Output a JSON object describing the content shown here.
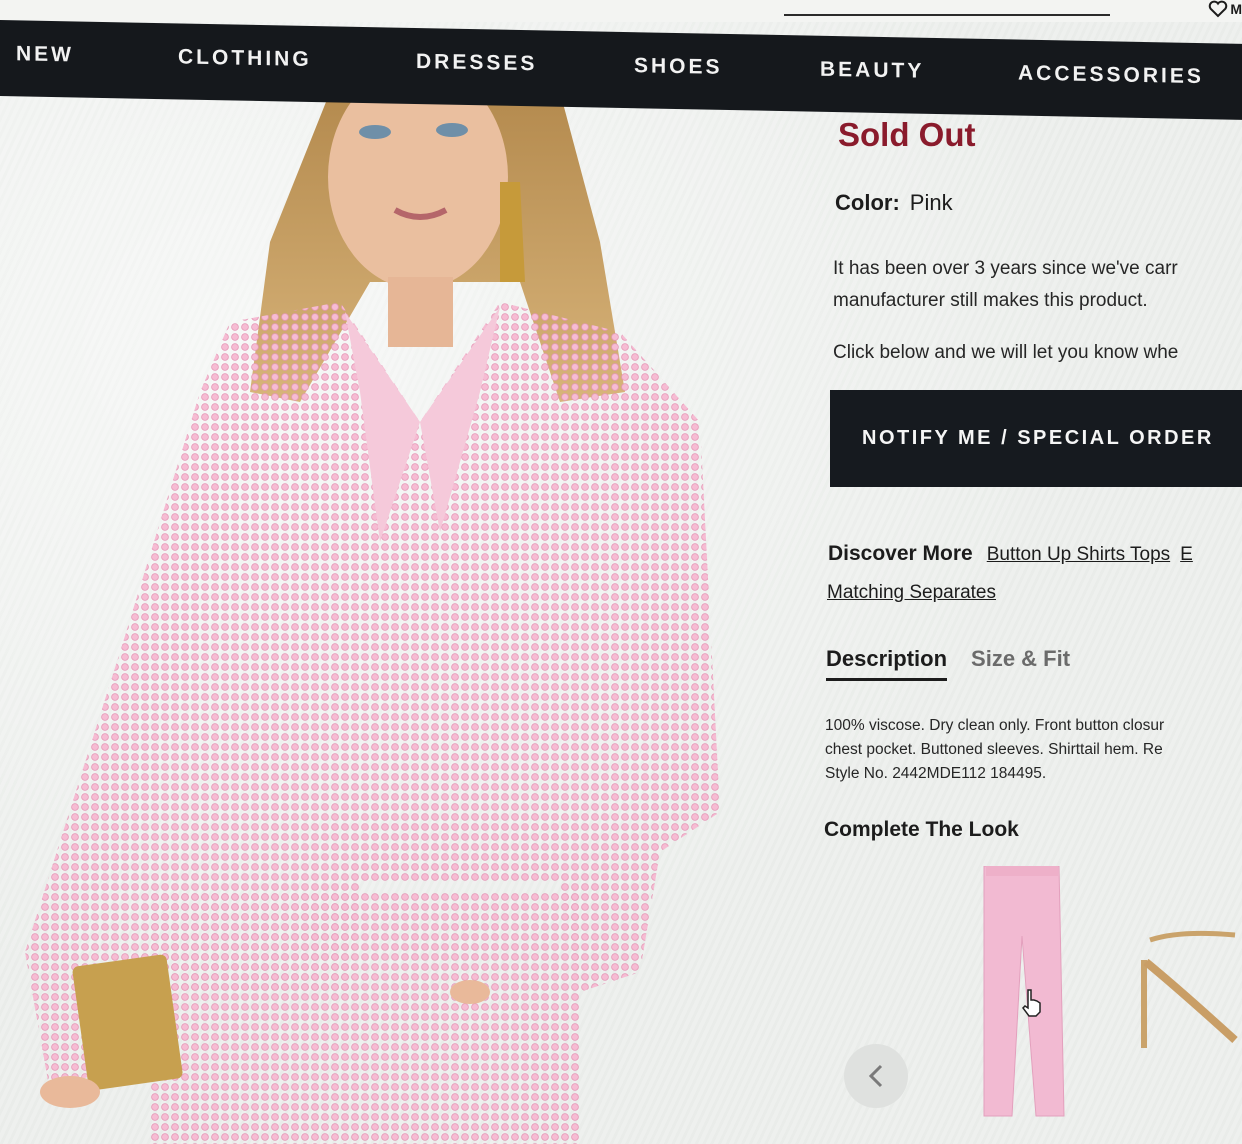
{
  "nav": {
    "items": [
      "NEW",
      "CLOTHING",
      "DRESSES",
      "SHOES",
      "BEAUTY",
      "ACCESSORIES"
    ]
  },
  "header": {
    "wishlist_label": "M",
    "wishlist_icon": "heart-icon"
  },
  "product": {
    "status": "Sold Out",
    "color_label": "Color:",
    "color_value": "Pink",
    "info_line1": "It has been over 3 years since we've carr",
    "info_line2": "manufacturer still makes this product.",
    "info_line3": "Click below and we will let you know whe",
    "notify_button": "NOTIFY ME / SPECIAL ORDER",
    "discover_label": "Discover More",
    "discover_links": [
      "Button Up Shirts Tops",
      "E",
      "Matching Separates"
    ],
    "tabs": [
      "Description",
      "Size & Fit"
    ],
    "description_lines": [
      "100% viscose. Dry clean only. Front button closur",
      "chest pocket. Buttoned sleeves. Shirttail hem. Re",
      "Style No. 2442MDE112 184495."
    ],
    "complete_look_title": "Complete The Look"
  },
  "colors": {
    "nav_bg": "#15181c",
    "sold_out": "#8a1b2c",
    "shirt_pink": "#f2a9c6"
  },
  "icons": {
    "prev": "chevron-left-icon",
    "cursor": "hand-pointer-icon"
  }
}
